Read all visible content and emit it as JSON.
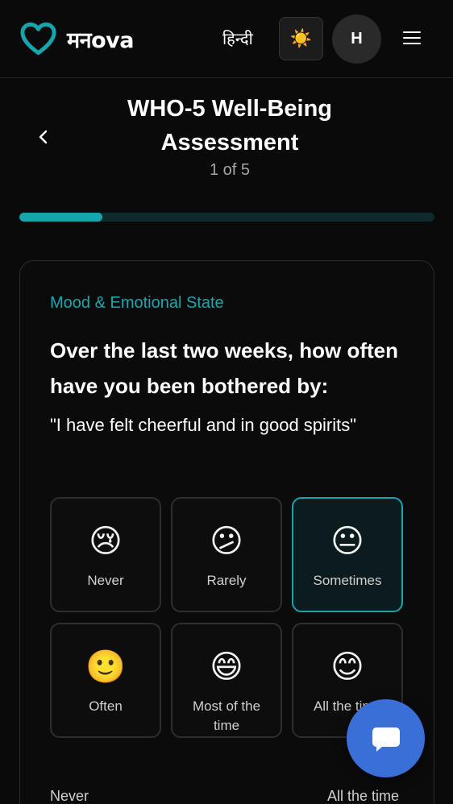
{
  "header": {
    "brand": "मनova",
    "language_label": "हिन्दी",
    "theme_icon": "☀️",
    "avatar_initial": "H"
  },
  "assessment": {
    "title": "WHO-5 Well-Being Assessment",
    "step": "1 of 5",
    "progress_fraction": 0.2
  },
  "question": {
    "category": "Mood & Emotional State",
    "prompt": "Over the last two weeks, how often have you been bothered by:",
    "statement": "\"I have felt cheerful and in good spirits\"",
    "options": [
      {
        "emoji": "😢",
        "label": "Never",
        "selected": false
      },
      {
        "emoji": "😕",
        "label": "Rarely",
        "selected": false
      },
      {
        "emoji": "😐",
        "label": "Sometimes",
        "selected": true
      },
      {
        "emoji": "🙂",
        "label": "Often",
        "selected": false
      },
      {
        "emoji": "😄",
        "label": "Most of the time",
        "selected": false
      },
      {
        "emoji": "😊",
        "label": "All the time",
        "selected": false
      }
    ],
    "scale_min_label": "Never",
    "scale_max_label": "All the time"
  },
  "colors": {
    "accent": "#17a5ad",
    "chat_button": "#3a6fd8"
  }
}
